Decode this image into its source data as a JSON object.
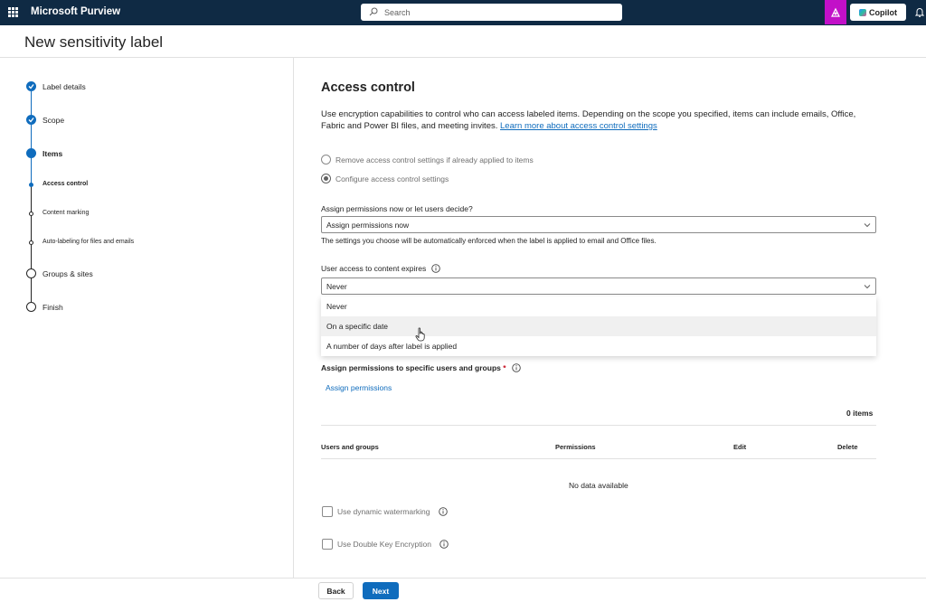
{
  "app": {
    "name": "Microsoft Purview"
  },
  "search": {
    "placeholder": "Search"
  },
  "header_actions": {
    "copilot_label": "Copilot"
  },
  "page": {
    "title": "New sensitivity label"
  },
  "steps": [
    {
      "label": "Label details",
      "state": "done"
    },
    {
      "label": "Scope",
      "state": "done"
    },
    {
      "label": "Items",
      "state": "current"
    },
    {
      "label": "Access control",
      "state": "current-sub"
    },
    {
      "label": "Content marking",
      "state": "sub"
    },
    {
      "label": "Auto-labeling for files and emails",
      "state": "sub"
    },
    {
      "label": "Groups & sites",
      "state": "todo"
    },
    {
      "label": "Finish",
      "state": "todo"
    }
  ],
  "section": {
    "title": "Access control",
    "description": "Use encryption capabilities to control who can access labeled items. Depending on the scope you specified, items can include emails, Office, Fabric and Power BI files, and meeting invites.",
    "learn_more": "Learn more about access control settings"
  },
  "radios": [
    {
      "label": "Remove access control settings if already applied to items",
      "checked": false
    },
    {
      "label": "Configure access control settings",
      "checked": true
    }
  ],
  "assign_mode": {
    "label": "Assign permissions now or let users decide?",
    "value": "Assign permissions now",
    "hint": "The settings you choose will be automatically enforced when the label is applied to email and Office files."
  },
  "expiry": {
    "label": "User access to content expires",
    "value": "Never",
    "options": [
      "Never",
      "On a specific date",
      "A number of days after label is applied"
    ],
    "hovered_option": "On a specific date"
  },
  "permissions": {
    "title": "Assign permissions to specific users and groups",
    "required_marker": "*",
    "assign_link": "Assign permissions",
    "count": "0 items",
    "columns": [
      "Users and groups",
      "Permissions",
      "Edit",
      "Delete"
    ],
    "empty_text": "No data available"
  },
  "checkboxes": [
    {
      "label": "Use dynamic watermarking",
      "checked": false
    },
    {
      "label": "Use Double Key Encryption",
      "checked": false
    }
  ],
  "footer": {
    "back_label": "Back",
    "next_label": "Next"
  },
  "colors": {
    "topbar": "#0f2a44",
    "accent": "#0f6cbd",
    "copilot_flag": "#c210c8",
    "required": "#c50f1f"
  },
  "icons": [
    "app-launcher-icon",
    "search-icon",
    "copilot-icon",
    "notification-bell-icon",
    "checkmark-icon",
    "info-icon",
    "chevron-down-icon",
    "pointer-cursor-icon"
  ]
}
